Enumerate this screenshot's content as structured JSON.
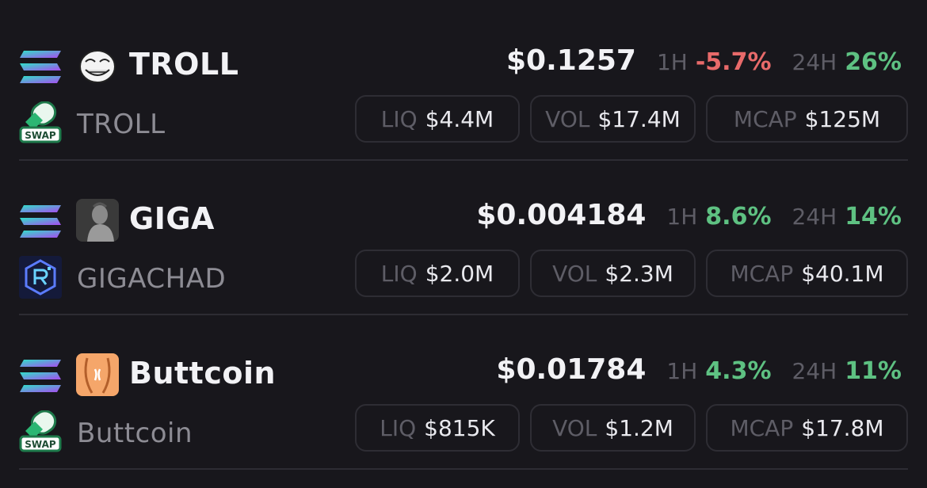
{
  "tokens": [
    {
      "symbol": "TROLL",
      "name": "TROLL",
      "avatar_icon": "troll-face-icon",
      "chain_icon": "solana-icon",
      "dex_icon": "swap-pill-icon",
      "price": "$0.1257",
      "change_1h_label": "1H",
      "change_1h": "-5.7%",
      "change_1h_dir": "negative",
      "change_24h_label": "24H",
      "change_24h": "26%",
      "change_24h_dir": "positive",
      "liq_label": "LIQ",
      "liq": "$4.4M",
      "vol_label": "VOL",
      "vol": "$17.4M",
      "mcap_label": "MCAP",
      "mcap": "$125M"
    },
    {
      "symbol": "GIGA",
      "name": "GIGACHAD",
      "avatar_icon": "gigachad-photo-icon",
      "chain_icon": "solana-icon",
      "dex_icon": "raydium-icon",
      "price": "$0.004184",
      "change_1h_label": "1H",
      "change_1h": "8.6%",
      "change_1h_dir": "positive",
      "change_24h_label": "24H",
      "change_24h": "14%",
      "change_24h_dir": "positive",
      "liq_label": "LIQ",
      "liq": "$2.0M",
      "vol_label": "VOL",
      "vol": "$2.3M",
      "mcap_label": "MCAP",
      "mcap": "$40.1M"
    },
    {
      "symbol": "Buttcoin",
      "name": "Buttcoin",
      "avatar_icon": "buttcoin-logo-icon",
      "chain_icon": "solana-icon",
      "dex_icon": "swap-pill-icon",
      "price": "$0.01784",
      "change_1h_label": "1H",
      "change_1h": "4.3%",
      "change_1h_dir": "positive",
      "change_24h_label": "24H",
      "change_24h": "11%",
      "change_24h_dir": "positive",
      "liq_label": "LIQ",
      "liq": "$815K",
      "vol_label": "VOL",
      "vol": "$1.2M",
      "mcap_label": "MCAP",
      "mcap": "$17.8M"
    }
  ],
  "swap_badge_text": "SWAP",
  "colors": {
    "background": "#18171c",
    "positive": "#5ec182",
    "negative": "#e86a6a",
    "muted_label": "#5e5d66",
    "pill_border": "#2e2d34"
  }
}
